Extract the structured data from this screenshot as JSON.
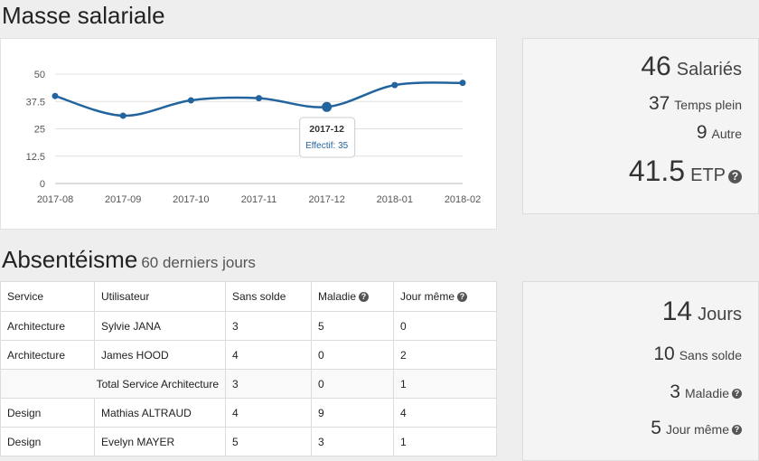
{
  "headers": {
    "masse": "Masse salariale",
    "absenteisme": "Absentéisme",
    "absenteisme_period": "60 derniers jours"
  },
  "chart_data": {
    "type": "line",
    "x": [
      "2017-08",
      "2017-09",
      "2017-10",
      "2017-11",
      "2017-12",
      "2018-01",
      "2018-02"
    ],
    "series": [
      {
        "values": [
          40,
          31,
          38,
          39,
          35,
          45,
          46
        ]
      }
    ],
    "yticks": [
      "0",
      "12.5",
      "25",
      "37.5",
      "50"
    ],
    "ylim": [
      0,
      50
    ],
    "grid": true,
    "tooltip": {
      "title": "2017-12",
      "text": "Effectif: 35"
    },
    "color": "#23649e"
  },
  "stats1": {
    "salaries_count": "46",
    "salaries_label": "Salariés",
    "temps_plein_count": "37",
    "temps_plein_label": "Temps plein",
    "autre_count": "9",
    "autre_label": "Autre",
    "etp_count": "41.5",
    "etp_label": "ETP"
  },
  "stats2": {
    "jours_count": "14",
    "jours_label": "Jours",
    "sans_solde_count": "10",
    "sans_solde_label": "Sans solde",
    "maladie_count": "3",
    "maladie_label": "Maladie",
    "jour_meme_count": "5",
    "jour_meme_label": "Jour même"
  },
  "table": {
    "columns": [
      "Service",
      "Utilisateur",
      "Sans solde",
      "Maladie",
      "Jour même"
    ],
    "rows": [
      [
        "Architecture",
        "Sylvie JANA",
        "3",
        "5",
        "0"
      ],
      [
        "Architecture",
        "James HOOD",
        "4",
        "0",
        "2"
      ],
      [
        "Total Service Architecture",
        "",
        "3",
        "0",
        "1"
      ],
      [
        "Design",
        "Mathias ALTRAUD",
        "4",
        "9",
        "4"
      ],
      [
        "Design",
        "Evelyn MAYER",
        "5",
        "3",
        "1"
      ]
    ]
  },
  "icons": {
    "help": "question-circle-icon"
  }
}
